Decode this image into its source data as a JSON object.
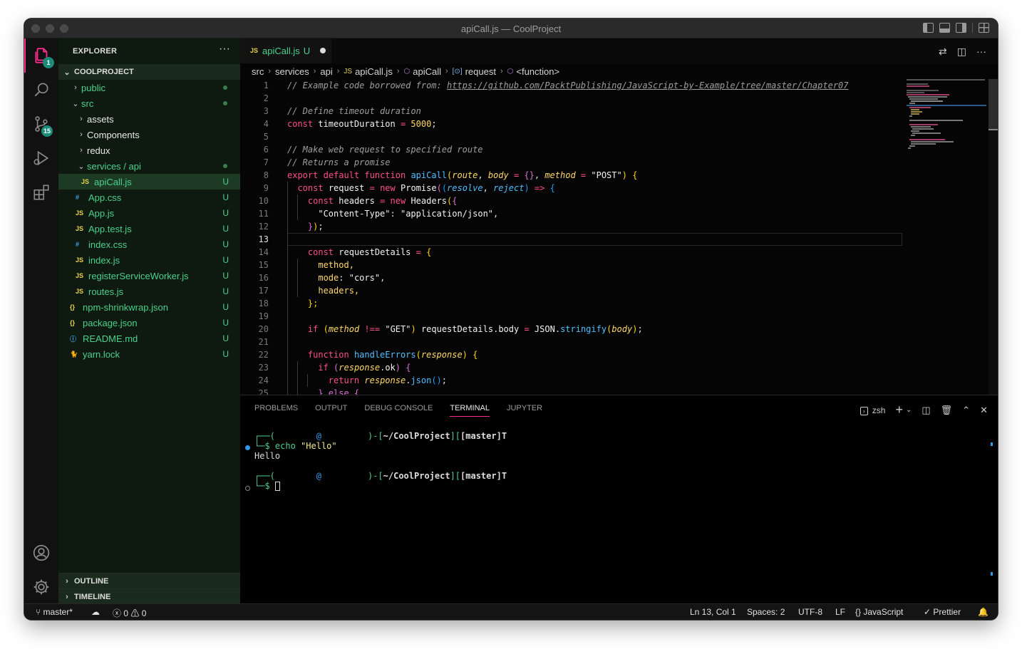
{
  "window": {
    "title": "apiCall.js — CoolProject"
  },
  "activity_bar": {
    "explorer_badge": "1",
    "scm_badge": "15"
  },
  "sidebar": {
    "title": "EXPLORER",
    "more": "···",
    "project": "COOLPROJECT",
    "rows": [
      {
        "label": "public",
        "chev": "›",
        "icon": "",
        "status": ""
      },
      {
        "label": "src",
        "chev": "⌄",
        "icon": "",
        "status": ""
      },
      {
        "label": "assets",
        "chev": "›",
        "icon": "",
        "status": ""
      },
      {
        "label": "Components",
        "chev": "›",
        "icon": "",
        "status": ""
      },
      {
        "label": "redux",
        "chev": "›",
        "icon": "",
        "status": ""
      },
      {
        "label": "services / api",
        "chev": "⌄",
        "icon": "",
        "status": ""
      },
      {
        "label": "apiCall.js",
        "chev": "",
        "icon": "JS",
        "status": "U"
      },
      {
        "label": "App.css",
        "chev": "",
        "icon": "#",
        "status": "U"
      },
      {
        "label": "App.js",
        "chev": "",
        "icon": "JS",
        "status": "U"
      },
      {
        "label": "App.test.js",
        "chev": "",
        "icon": "JS",
        "status": "U"
      },
      {
        "label": "index.css",
        "chev": "",
        "icon": "#",
        "status": "U"
      },
      {
        "label": "index.js",
        "chev": "",
        "icon": "JS",
        "status": "U"
      },
      {
        "label": "registerServiceWorker.js",
        "chev": "",
        "icon": "JS",
        "status": "U"
      },
      {
        "label": "routes.js",
        "chev": "",
        "icon": "JS",
        "status": "U"
      },
      {
        "label": "npm-shrinkwrap.json",
        "chev": "",
        "icon": "{}",
        "status": "U"
      },
      {
        "label": "package.json",
        "chev": "",
        "icon": "{}",
        "status": "U"
      },
      {
        "label": "README.md",
        "chev": "",
        "icon": "ⓘ",
        "status": "U"
      },
      {
        "label": "yarn.lock",
        "chev": "",
        "icon": "🐈",
        "status": "U"
      }
    ],
    "outline": "OUTLINE",
    "timeline": "TIMELINE"
  },
  "editor": {
    "tab": {
      "icon": "JS",
      "name": "apiCall.js",
      "status": "U"
    },
    "breadcrumb": [
      "src",
      "services",
      "api",
      "apiCall.js",
      "apiCall",
      "request",
      "<function>"
    ],
    "line_numbers": [
      "1",
      "2",
      "3",
      "4",
      "5",
      "6",
      "7",
      "8",
      "9",
      "10",
      "11",
      "12",
      "13",
      "14",
      "15",
      "16",
      "17",
      "18",
      "19",
      "20",
      "21",
      "22",
      "23",
      "24",
      "25"
    ],
    "current_line": "13",
    "code": {
      "l1_comment": "// Example code borrowed from: ",
      "l1_link": "https://github.com/PacktPublishing/JavaScript-by-Example/tree/master/Chapter07",
      "l3": "// Define timeout duration",
      "l4_kw": "const",
      "l4_var": "timeoutDuration",
      "l4_eq": " = ",
      "l4_num": "5000",
      "l4_end": ";",
      "l6": "// Make web request to specified route",
      "l7": "// Returns a promise",
      "l8_export": "export",
      "l8_default": "default",
      "l8_function": "function",
      "l8_name": "apiCall",
      "l8_route": "route",
      "l8_body": "body",
      "l8_method": "method",
      "l8_post": "\"POST\"",
      "l9_const": "const",
      "l9_var": "request",
      "l9_new": "new",
      "l9_cls": "Promise",
      "l9_resolve": "resolve",
      "l9_reject": "reject",
      "l10_const": "const",
      "l10_var": "headers",
      "l10_new": "new",
      "l10_cls": "Headers",
      "l11_key": "\"Content-Type\"",
      "l11_val": "\"application/json\"",
      "l12": "});",
      "l14_const": "const",
      "l14_var": "requestDetails",
      "l15": "method,",
      "l16_key": "mode",
      "l16_val": "\"cors\"",
      "l17": "headers,",
      "l18": "};",
      "l20_if": "if",
      "l20_method": "method",
      "l20_op": "!==",
      "l20_get": "\"GET\"",
      "l20_obj": "requestDetails",
      "l20_prop": "body",
      "l20_json": "JSON",
      "l20_fn": "stringify",
      "l20_arg": "body",
      "l22_function": "function",
      "l22_name": "handleErrors",
      "l22_param": "response",
      "l23_if": "if",
      "l23_obj": "response",
      "l23_prop": "ok",
      "l24_return": "return",
      "l24_obj": "response",
      "l24_fn": "json",
      "l25": "} else {"
    }
  },
  "panel": {
    "tabs": [
      "PROBLEMS",
      "OUTPUT",
      "DEBUG CONSOLE",
      "TERMINAL",
      "JUPYTER"
    ],
    "active_tab": "TERMINAL",
    "shell": "zsh",
    "terminal": {
      "prompt_top_a": "┌──(",
      "prompt_at": "@",
      "prompt_top_b": ")-[",
      "prompt_path": "~/CoolProject",
      "prompt_top_c": "][",
      "prompt_branch": "[master]T",
      "prompt_bottom": "└─$ ",
      "cmd": "echo",
      "arg": "\"Hello\"",
      "output": "Hello"
    }
  },
  "statusbar": {
    "branch": "master*",
    "errors": "0",
    "warnings": "0",
    "position": "Ln 13, Col 1",
    "spaces": "Spaces: 2",
    "encoding": "UTF-8",
    "eol": "LF",
    "language": "JavaScript",
    "prettier": "Prettier"
  }
}
